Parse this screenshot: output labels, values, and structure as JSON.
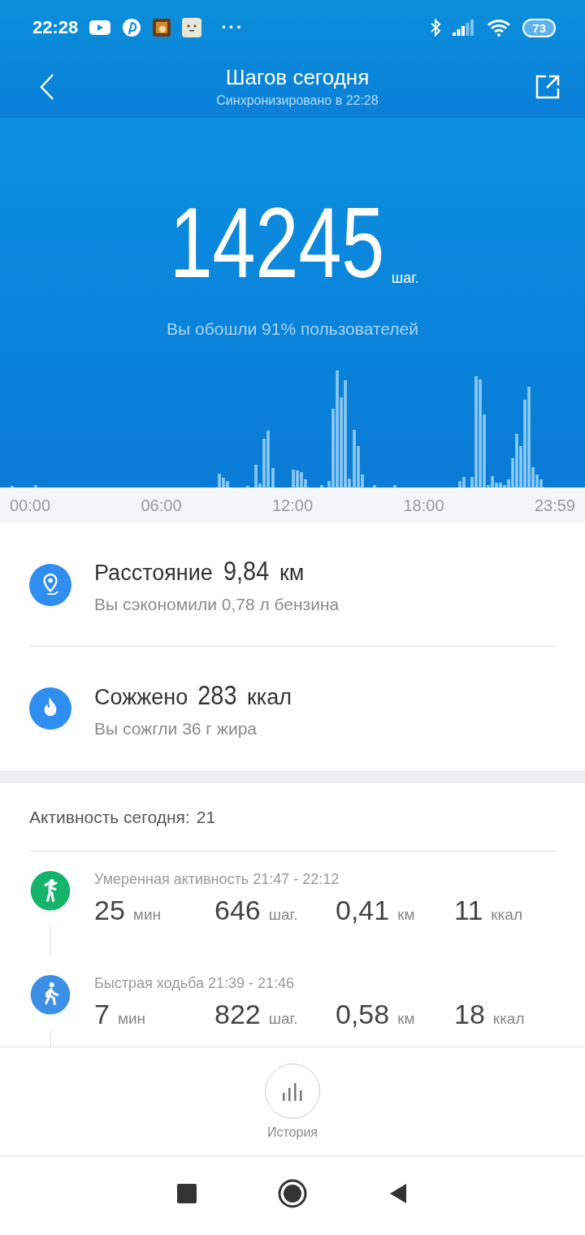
{
  "status_bar": {
    "time": "22:28",
    "more": "···",
    "battery": "73"
  },
  "header": {
    "title": "Шагов сегодня",
    "subtitle": "Синхронизировано в 22:28"
  },
  "summary": {
    "steps": "14245",
    "unit": "шаг.",
    "comparison": "Вы обошли 91% пользователей"
  },
  "chart_axis": [
    "00:00",
    "06:00",
    "12:00",
    "18:00",
    "23:59"
  ],
  "stats": [
    {
      "kind": "distance",
      "label": "Расстояние",
      "value": "9,84",
      "unit": "км",
      "note": "Вы сэкономили 0,78 л бензина"
    },
    {
      "kind": "calories",
      "label": "Сожжено",
      "value": "283",
      "unit": "ккал",
      "note": "Вы сожгли 36 г жира"
    }
  ],
  "activity": {
    "label": "Активность сегодня:",
    "count": "21",
    "items": [
      {
        "kind": "moderate",
        "title": "Умеренная активность 21:47 - 22:12",
        "stats": [
          {
            "value": "25",
            "unit": "мин"
          },
          {
            "value": "646",
            "unit": "шаг."
          },
          {
            "value": "0,41",
            "unit": "км"
          },
          {
            "value": "11",
            "unit": "ккал"
          }
        ]
      },
      {
        "kind": "walk",
        "title": "Быстрая ходьба 21:39 - 21:46",
        "stats": [
          {
            "value": "7",
            "unit": "мин"
          },
          {
            "value": "822",
            "unit": "шаг."
          },
          {
            "value": "0,58",
            "unit": "км"
          },
          {
            "value": "18",
            "unit": "ккал"
          }
        ]
      }
    ]
  },
  "history_button": {
    "label": "История"
  }
}
